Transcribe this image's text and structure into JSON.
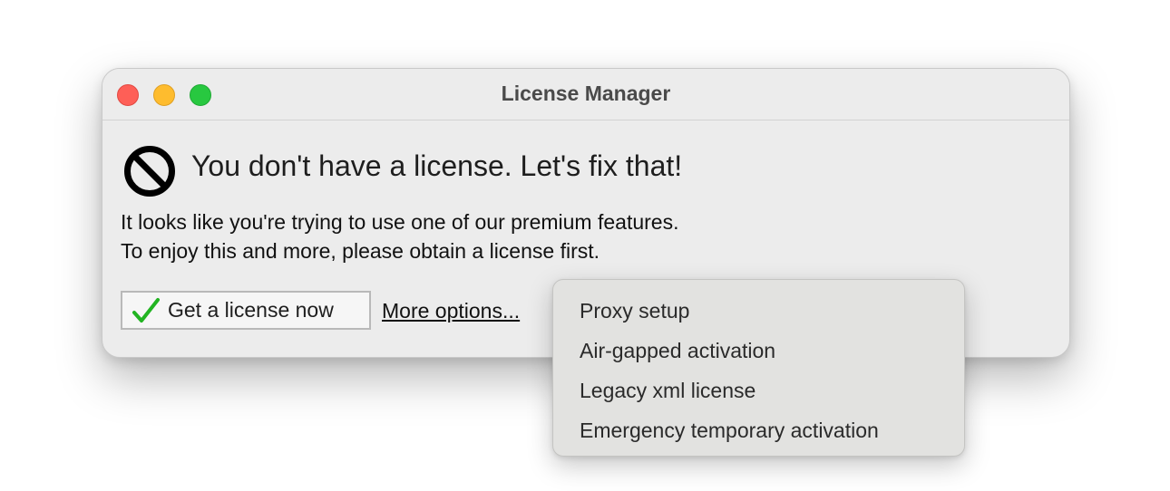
{
  "window": {
    "title": "License Manager"
  },
  "dialog": {
    "heading": "You don't have a license. Let's fix that!",
    "body_line1": "It looks like you're trying to use one of our premium features.",
    "body_line2": "To enjoy this and more, please obtain a license first.",
    "status_icon": "prohibited-icon"
  },
  "actions": {
    "get_license_label": "Get a license now",
    "get_license_icon": "checkmark-icon",
    "more_options_label": "More options..."
  },
  "menu": {
    "items": [
      {
        "label": "Proxy setup"
      },
      {
        "label": "Air-gapped activation"
      },
      {
        "label": "Legacy xml license"
      },
      {
        "label": "Emergency temporary activation"
      }
    ]
  },
  "colors": {
    "close": "#fe5f57",
    "minimize": "#febc2e",
    "maximize": "#28c840",
    "check": "#22b422",
    "window_bg": "#ececec",
    "menu_bg": "#e2e2e0"
  }
}
